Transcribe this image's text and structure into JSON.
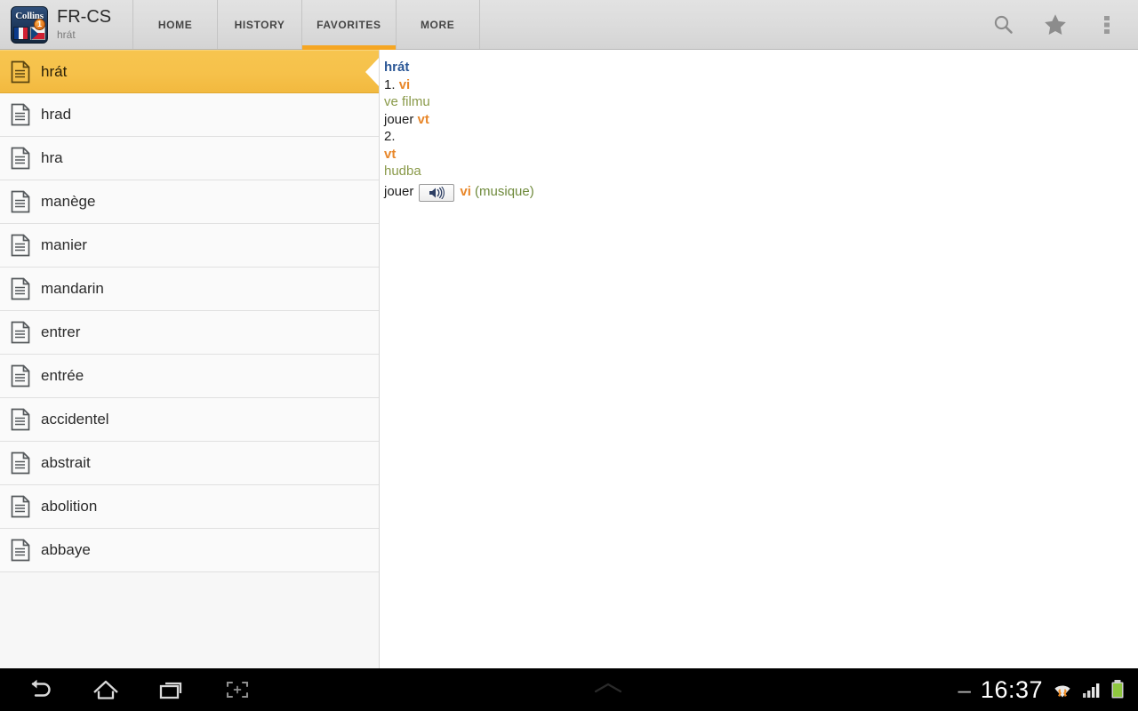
{
  "app": {
    "title": "FR-CS",
    "subtitle": "hrát",
    "logo": {
      "brand_text": "Collins",
      "badge_text": "1",
      "flag_left": "french-flag",
      "flag_right": "czech-flag"
    }
  },
  "tabs": [
    {
      "label": "HOME",
      "active": false,
      "name": "tab-home"
    },
    {
      "label": "HISTORY",
      "active": false,
      "name": "tab-history"
    },
    {
      "label": "FAVORITES",
      "active": true,
      "name": "tab-favorites"
    },
    {
      "label": "MORE",
      "active": false,
      "name": "tab-more"
    }
  ],
  "actions": [
    {
      "name": "search-icon",
      "label": "Search"
    },
    {
      "name": "star-icon",
      "label": "Favorites"
    },
    {
      "name": "overflow-menu-icon",
      "label": "More options"
    }
  ],
  "word_list": [
    {
      "label": "hrát",
      "selected": true
    },
    {
      "label": "hrad",
      "selected": false
    },
    {
      "label": "hra",
      "selected": false
    },
    {
      "label": "manège",
      "selected": false
    },
    {
      "label": "manier",
      "selected": false
    },
    {
      "label": "mandarin",
      "selected": false
    },
    {
      "label": "entrer",
      "selected": false
    },
    {
      "label": "entrée",
      "selected": false
    },
    {
      "label": "accidentel",
      "selected": false
    },
    {
      "label": "abstrait",
      "selected": false
    },
    {
      "label": "abolition",
      "selected": false
    },
    {
      "label": "abbaye",
      "selected": false
    }
  ],
  "definition": {
    "headword": "hrát",
    "sense1_number": "1.",
    "sense1_pos": "vi",
    "sense1_context": "ve filmu",
    "sense1_translation": "jouer",
    "sense1_translation_pos": "vt",
    "sense2_number": "2.",
    "sense2_pos": "vt",
    "sense2_context": "hudba",
    "sense2_translation": "jouer",
    "sense2_translation_pos": "vi",
    "sense2_paren_open": "(",
    "sense2_paren_text": "musique",
    "sense2_paren_close": ")",
    "audio_button_name": "speaker-icon"
  },
  "system_nav": {
    "buttons": [
      {
        "name": "back-button",
        "label": "Back"
      },
      {
        "name": "home-button",
        "label": "Home"
      },
      {
        "name": "recent-apps-button",
        "label": "Recent apps"
      },
      {
        "name": "screenshot-button",
        "label": "Screenshot"
      }
    ],
    "handle_name": "notification-handle"
  },
  "status_bar": {
    "dash": "–",
    "clock": "16:37",
    "wifi_name": "wifi-icon",
    "signal_name": "cellular-signal-icon",
    "battery_name": "battery-icon"
  },
  "colors": {
    "accent_orange": "#f5a623",
    "selected_row": "#f6c14a",
    "headword_blue": "#2b5796",
    "pos_orange": "#e8872a",
    "context_green": "#8a9a4a",
    "actionbar_gray": "#dcdcdc",
    "battery_green": "#8ec63f"
  }
}
